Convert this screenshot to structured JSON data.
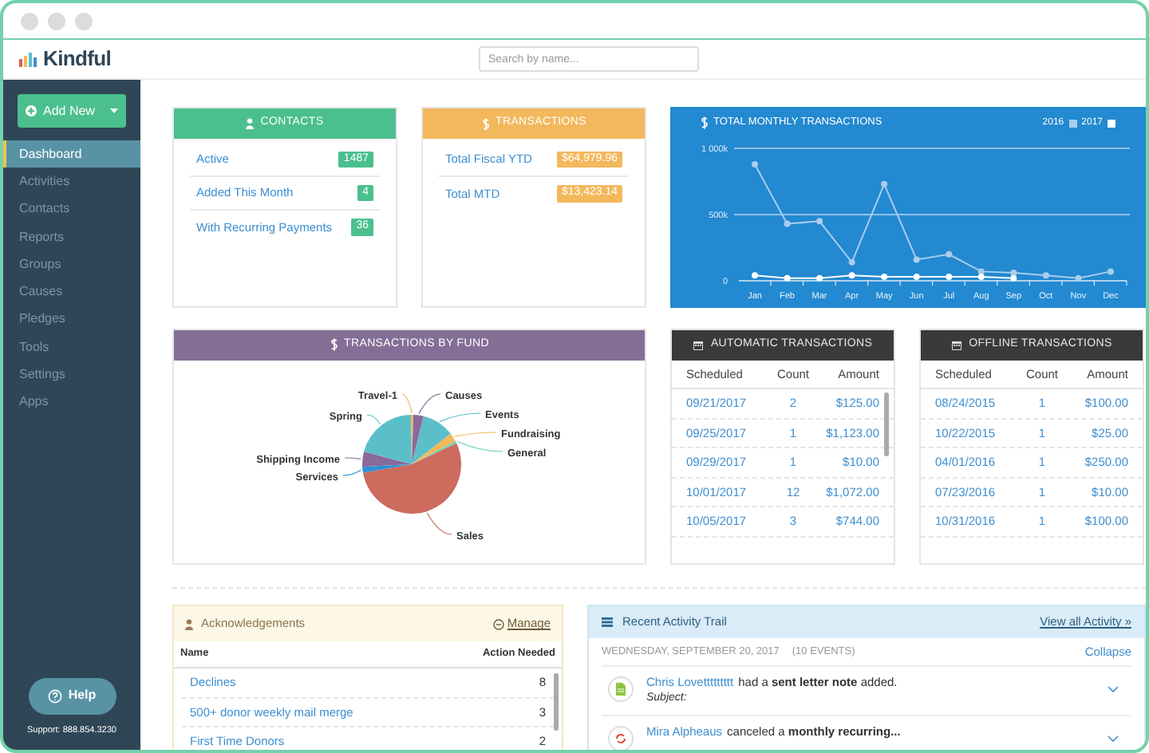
{
  "header": {
    "logo": "Kindful",
    "search": {
      "placeholder": "Search by name..."
    }
  },
  "sidebar": {
    "add_button": "Add New",
    "items": [
      {
        "label": "Dashboard",
        "selected": true
      },
      {
        "label": "Activities",
        "selected": false
      },
      {
        "label": "Contacts",
        "selected": false
      },
      {
        "label": "Reports",
        "selected": false
      },
      {
        "label": "Groups",
        "selected": false
      },
      {
        "label": "Causes",
        "selected": false
      },
      {
        "label": "Pledges",
        "selected": false
      },
      {
        "label": "Tools",
        "selected": false
      },
      {
        "label": "Settings",
        "selected": false
      },
      {
        "label": "Apps",
        "selected": false
      }
    ],
    "help_button": "Help",
    "support": "Support: 888.854.3230"
  },
  "contacts": {
    "title": "CONTACTS",
    "rows": [
      {
        "label": "Active",
        "count": "1487"
      },
      {
        "label": "Added This Month",
        "count": "4"
      },
      {
        "label": "With Recurring Payments",
        "count": "36"
      }
    ]
  },
  "transactions": {
    "title": "TRANSACTIONS",
    "rows": [
      {
        "label": "Total Fiscal YTD",
        "amount": "$64,979.96"
      },
      {
        "label": "Total MTD",
        "amount": "$13,423.14"
      }
    ]
  },
  "monthly_chart": {
    "chart_data": {
      "type": "line",
      "title": "TOTAL MONTHLY TRANSACTIONS",
      "categories": [
        "Jan",
        "Feb",
        "Mar",
        "Apr",
        "May",
        "Jun",
        "Jul",
        "Aug",
        "Sep",
        "Oct",
        "Nov",
        "Dec"
      ],
      "series": [
        {
          "name": "2016",
          "color": "#a9cdee",
          "marker": "circle",
          "values": [
            880000,
            430000,
            450000,
            140000,
            730000,
            160000,
            200000,
            70000,
            60000,
            40000,
            20000,
            70000
          ]
        },
        {
          "name": "2017",
          "color": "#ffffff",
          "marker": "circle",
          "values": [
            40000,
            20000,
            20000,
            40000,
            30000,
            30000,
            30000,
            30000,
            20000,
            null,
            null,
            null
          ]
        }
      ],
      "legend": "top-right",
      "ref_lines": [
        {
          "axis": "y",
          "value": 500000
        },
        {
          "axis": "y",
          "value": 1000000
        }
      ],
      "ylim": [
        0,
        1000000
      ],
      "yticks": [
        {
          "value": 0,
          "label": "0"
        },
        {
          "value": 500000,
          "label": "500k"
        },
        {
          "value": 1000000,
          "label": "1 000k"
        }
      ]
    }
  },
  "fund_chart": {
    "title": "TRANSACTIONS BY FUND",
    "funds": [
      {
        "label": "Travel-1",
        "color": "#f3b85c"
      },
      {
        "label": "Causes",
        "color": "#8a6a9a"
      },
      {
        "label": "Events",
        "color": "#5bbfc9"
      },
      {
        "label": "Fundraising",
        "color": "#f3b85c"
      },
      {
        "label": "General",
        "color": "#6fcfb5"
      },
      {
        "label": "Sales",
        "color": "#cc6b5e"
      },
      {
        "label": "Shipping Income",
        "color": "#8a6a9a"
      },
      {
        "label": "Services",
        "color": "#2d8fd5"
      },
      {
        "label": "Spring",
        "color": "#5bbfc9"
      }
    ]
  },
  "automatic_transactions": {
    "title": "AUTOMATIC TRANSACTIONS",
    "columns": [
      "Scheduled",
      "Count",
      "Amount"
    ],
    "rows": [
      [
        "09/21/2017",
        "2",
        "$125.00"
      ],
      [
        "09/25/2017",
        "1",
        "$1,123.00"
      ],
      [
        "09/29/2017",
        "1",
        "$10.00"
      ],
      [
        "10/01/2017",
        "12",
        "$1,072.00"
      ],
      [
        "10/05/2017",
        "3",
        "$744.00"
      ]
    ]
  },
  "offline_transactions": {
    "title": "OFFLINE TRANSACTIONS",
    "columns": [
      "Scheduled",
      "Count",
      "Amount"
    ],
    "rows": [
      [
        "08/24/2015",
        "1",
        "$100.00"
      ],
      [
        "10/22/2015",
        "1",
        "$25.00"
      ],
      [
        "04/01/2016",
        "1",
        "$250.00"
      ],
      [
        "07/23/2016",
        "1",
        "$10.00"
      ],
      [
        "10/31/2016",
        "1",
        "$100.00"
      ]
    ]
  },
  "acknowledgements": {
    "title": "Acknowledgements",
    "manage": "Manage",
    "columns": [
      "Name",
      "Action Needed"
    ],
    "rows": [
      {
        "name": "Declines",
        "count": "8"
      },
      {
        "name": "500+ donor weekly mail merge",
        "count": "3"
      },
      {
        "name": "First Time Donors",
        "count": "2"
      }
    ]
  },
  "activity": {
    "title": "Recent Activity Trail",
    "view_all": "View all Activity »",
    "date": "WEDNESDAY, SEPTEMBER 20, 2017",
    "event_count": "(10 EVENTS)",
    "collapse": "Collapse",
    "events": [
      {
        "kind": "note",
        "name": "Chris Lovettttttttt",
        "text": "had a **sent letter note** added.",
        "subject": "Subject:"
      },
      {
        "kind": "recurring",
        "name": "Mira Alpheaus",
        "text": "canceled a **monthly recurring...**"
      }
    ]
  }
}
